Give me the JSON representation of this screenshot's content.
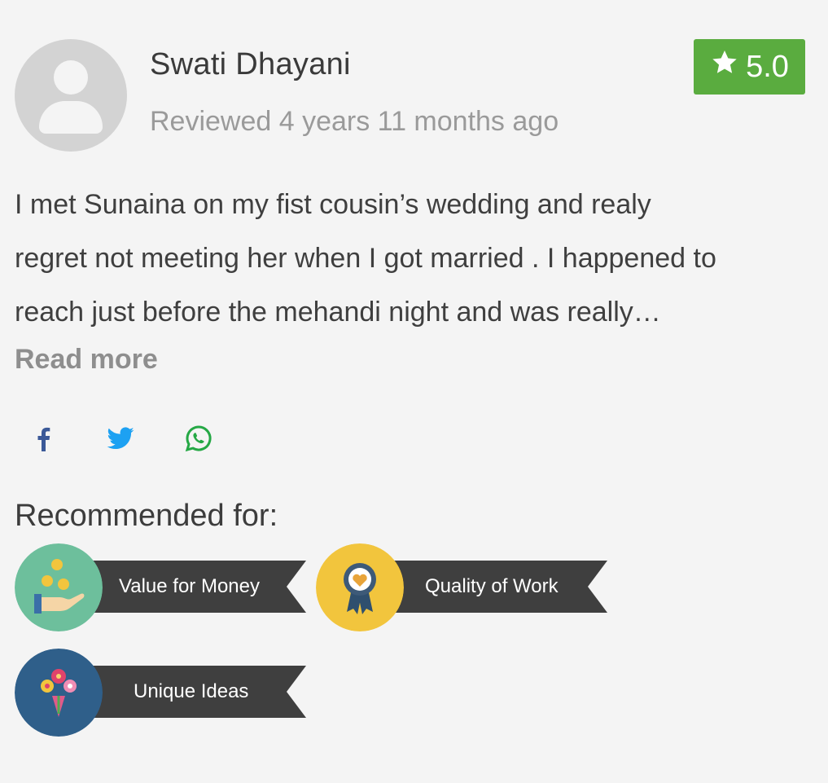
{
  "reviewer": {
    "name": "Swati Dhayani",
    "reviewed": "Reviewed 4 years 11 months ago",
    "avatar_icon": "user-avatar-icon"
  },
  "rating": {
    "value": "5.0",
    "icon": "star-icon",
    "color": "#5aac3f"
  },
  "review": {
    "lines": [
      "I met Sunaina on my fist cousin’s wedding and realy",
      "regret not meeting her when I got married . I happened to",
      "reach just before the mehandi night and was really…"
    ],
    "read_more": "Read more"
  },
  "share": {
    "facebook_icon": "facebook-icon",
    "twitter_icon": "twitter-icon",
    "whatsapp_icon": "whatsapp-icon"
  },
  "recommended": {
    "title": "Recommended for:",
    "items": [
      {
        "label": "Value for Money",
        "icon": "money-hand-icon",
        "color": "#6dbf9c"
      },
      {
        "label": "Quality of Work",
        "icon": "award-ribbon-icon",
        "color": "#f2c53d"
      },
      {
        "label": "Unique Ideas",
        "icon": "flower-bouquet-icon",
        "color": "#2f5f8a"
      }
    ]
  }
}
